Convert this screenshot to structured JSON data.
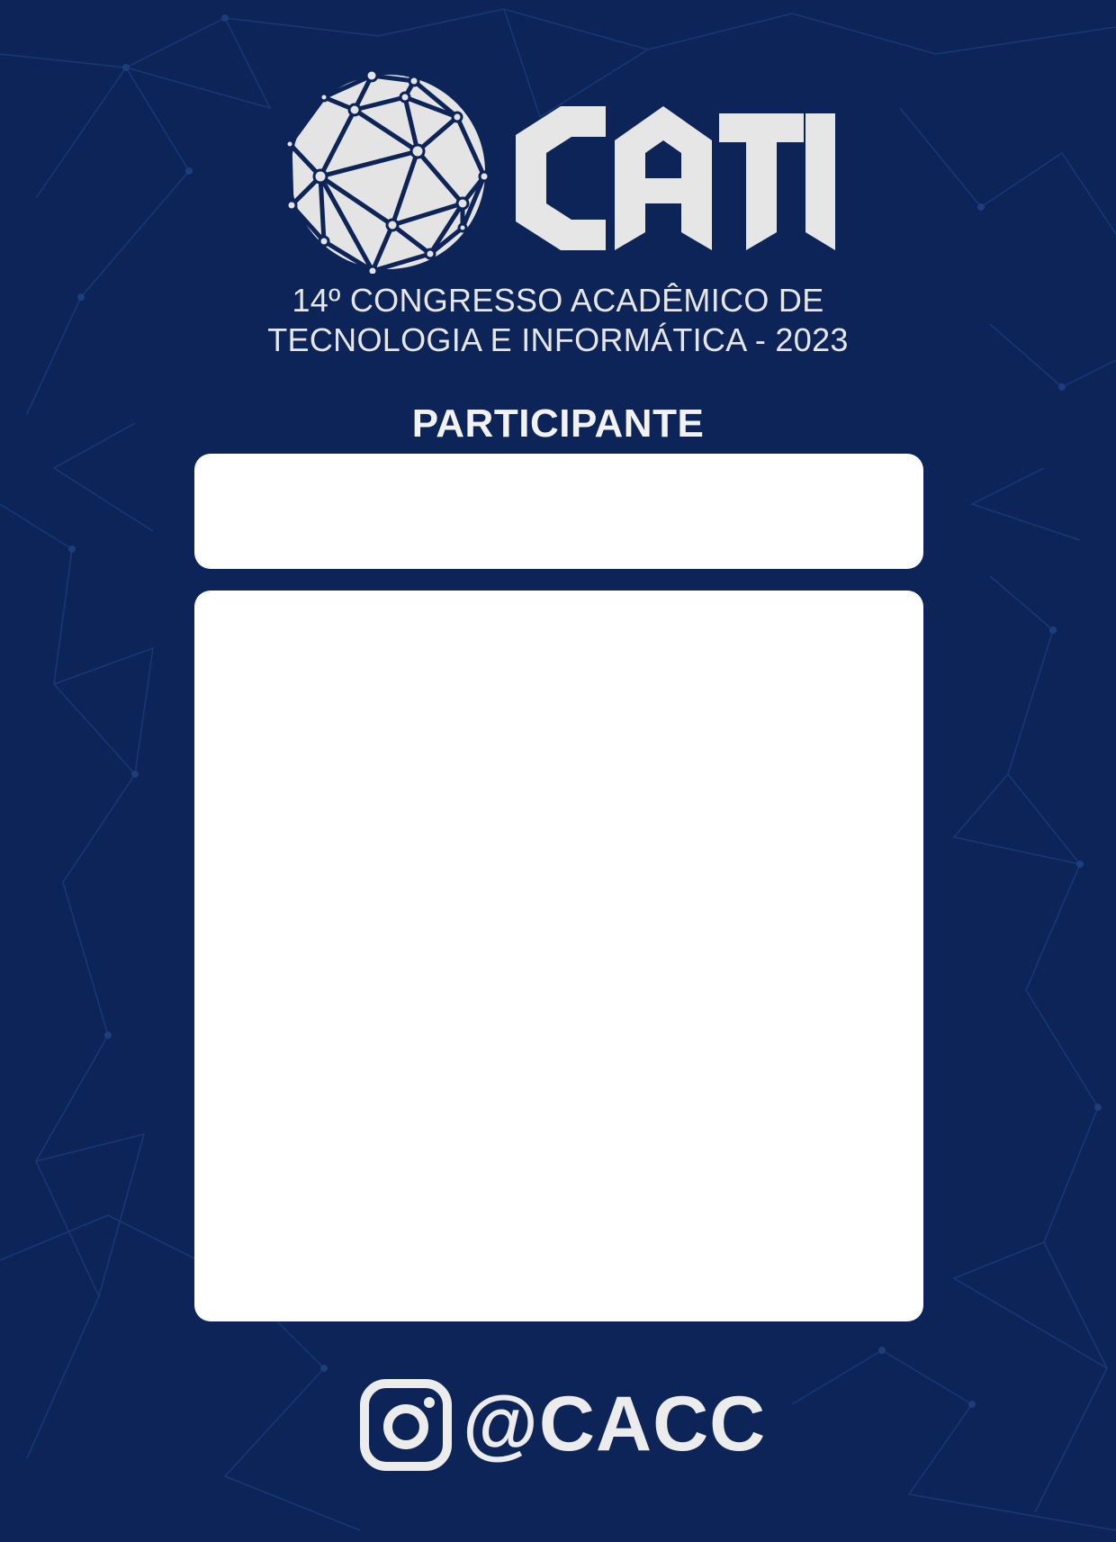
{
  "colors": {
    "background": "#0c2458",
    "network_lines": "#1e3d7a",
    "foreground": "#ececec",
    "card": "#ffffff"
  },
  "logo": {
    "wordmark": "CATI",
    "icon": "geodesic-globe-icon"
  },
  "subtitle": {
    "line1": "14º CONGRESSO ACADÊMICO DE",
    "line2": "TECNOLOGIA E INFORMÁTICA - 2023"
  },
  "role_label": "PARTICIPANTE",
  "name_field": {
    "value": ""
  },
  "photo_area": {
    "value": ""
  },
  "social": {
    "icon": "instagram-icon",
    "handle": "@CACC"
  }
}
